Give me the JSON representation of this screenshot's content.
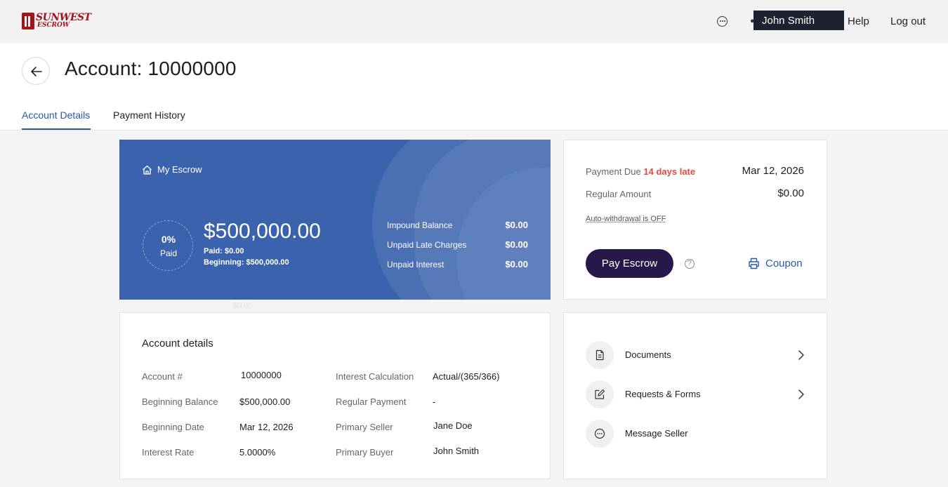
{
  "brand": {
    "name_line1": "SUNWEST",
    "name_line2": "ESCROW"
  },
  "topbar": {
    "user_name": "John Smith",
    "help": "Help",
    "logout": "Log out"
  },
  "header": {
    "title": "Account: 10000000"
  },
  "tabs": [
    {
      "label": "Account Details",
      "active": true
    },
    {
      "label": "Payment History",
      "active": false
    }
  ],
  "escrow": {
    "label": "My Escrow",
    "percent_paid": "0%",
    "paid_label": "Paid",
    "balance": "$500,000.00",
    "paid": "Paid: $0.00",
    "beginning": "Beginning: $500,000.00",
    "balances": [
      {
        "label": "Impound Balance",
        "value": "$0.00"
      },
      {
        "label": "Unpaid Late Charges",
        "value": "$0.00"
      },
      {
        "label": "Unpaid Interest",
        "value": "$0.00"
      }
    ],
    "ghost_value": "$0.00",
    "colors": {
      "card": "#3b63ad"
    }
  },
  "payment": {
    "due_label": "Payment Due",
    "late_text": "14 days late",
    "due_date": "Mar 12, 2026",
    "regular_label": "Regular Amount",
    "regular_value": "$0.00",
    "auto_withdrawal": "Auto-withdrawal is OFF",
    "pay_button": "Pay Escrow",
    "coupon": "Coupon",
    "colors": {
      "late": "#e04b40",
      "button": "#261949",
      "link": "#2a57a8"
    }
  },
  "details": {
    "title": "Account details",
    "left": [
      {
        "label": "Account #",
        "value": "10000000"
      },
      {
        "label": "Beginning Balance",
        "value": "$500,000.00"
      },
      {
        "label": "Beginning Date",
        "value": "Mar 12, 2026"
      },
      {
        "label": "Interest Rate",
        "value": "5.0000%"
      }
    ],
    "right": [
      {
        "label": "Interest Calculation",
        "value": "Actual/(365/366)"
      },
      {
        "label": "Regular Payment",
        "value": "-"
      },
      {
        "label": "Primary Seller",
        "value": "Jane Doe"
      },
      {
        "label": "Primary Buyer",
        "value": "John Smith"
      }
    ]
  },
  "links": [
    {
      "label": "Documents",
      "icon": "document-icon",
      "chevron": true
    },
    {
      "label": "Requests & Forms",
      "icon": "edit-icon",
      "chevron": true
    },
    {
      "label": "Message Seller",
      "icon": "message-icon",
      "chevron": false
    }
  ]
}
